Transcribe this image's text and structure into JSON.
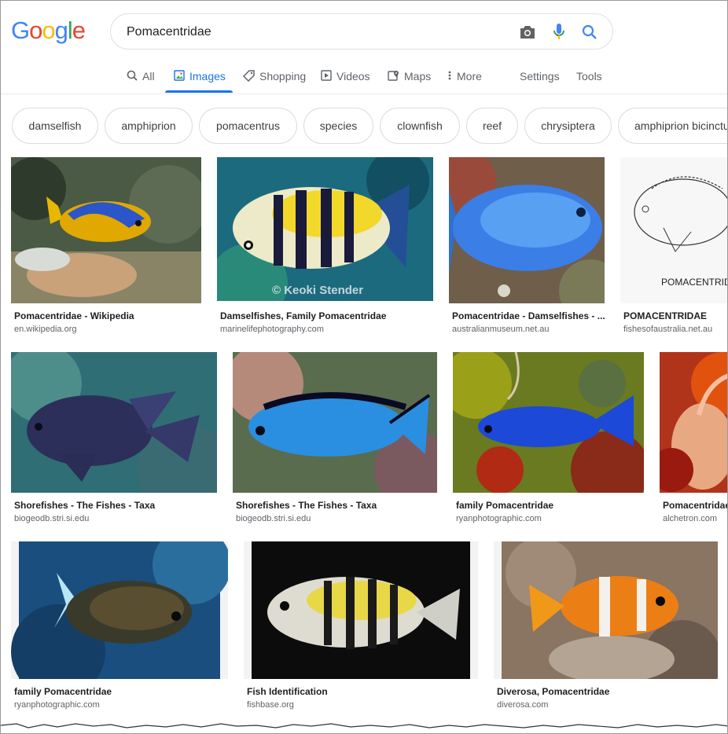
{
  "brand": {
    "letters": [
      "G",
      "o",
      "o",
      "g",
      "l",
      "e"
    ],
    "colors": [
      "#4285f4",
      "#ea4335",
      "#fbbc05",
      "#4285f4",
      "#34a853",
      "#ea4335"
    ]
  },
  "search": {
    "query": "Pomacentridae",
    "icons": [
      "camera-icon",
      "microphone-icon",
      "search-icon"
    ]
  },
  "tabs": {
    "all": "All",
    "images": "Images",
    "shopping": "Shopping",
    "videos": "Videos",
    "maps": "Maps",
    "more": "More",
    "settings": "Settings",
    "tools": "Tools"
  },
  "chips": [
    "damselfish",
    "amphiprion",
    "pomacentrus",
    "species",
    "clownfish",
    "reef",
    "chrysiptera",
    "amphiprion bicinctus"
  ],
  "results": [
    {
      "title": "Pomacentridae - Wikipedia",
      "site": "en.wikipedia.org"
    },
    {
      "title": "Damselfishes, Family Pomacentridae",
      "site": "marinelifephotography.com",
      "watermark": "© Keoki Stender"
    },
    {
      "title": "Pomacentridae - Damselfishes - ...",
      "site": "australianmuseum.net.au"
    },
    {
      "title": "POMACENTRIDAE",
      "site": "fishesofaustralia.net.au",
      "image_text": "POMACENTRID"
    },
    {
      "title": "Shorefishes - The Fishes - Taxa",
      "site": "biogeodb.stri.si.edu"
    },
    {
      "title": "Shorefishes - The Fishes - Taxa",
      "site": "biogeodb.stri.si.edu"
    },
    {
      "title": "family Pomacentridae",
      "site": "ryanphotographic.com"
    },
    {
      "title": "Pomacentridae",
      "site": "alchetron.com"
    },
    {
      "title": "family Pomacentridae",
      "site": "ryanphotographic.com"
    },
    {
      "title": "Fish Identification",
      "site": "fishbase.org"
    },
    {
      "title": "Diverosa, Pomacentridae",
      "site": "diverosa.com"
    }
  ],
  "colors": {
    "accent": "#1a73e8",
    "text": "#202124",
    "secondary": "#5f6368",
    "border": "#dfe1e5"
  }
}
